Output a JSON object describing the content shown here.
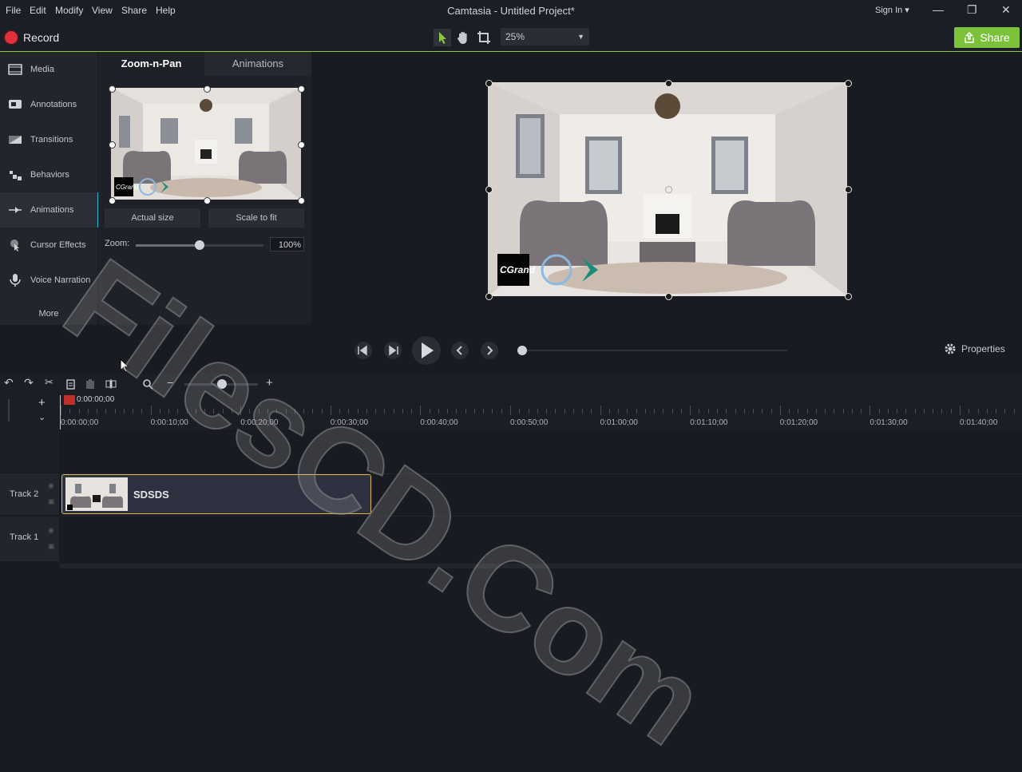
{
  "menu": [
    "File",
    "Edit",
    "Modify",
    "View",
    "Share",
    "Help"
  ],
  "window": {
    "title": "Camtasia - Untitled Project*",
    "sign_in": "Sign In ▾"
  },
  "toolbar": {
    "record_label": "Record",
    "zoom": "25%",
    "share_label": "Share"
  },
  "sidebar": {
    "items": [
      {
        "label": "Media",
        "icon": "film-icon"
      },
      {
        "label": "Annotations",
        "icon": "annotation-icon"
      },
      {
        "label": "Transitions",
        "icon": "transition-icon"
      },
      {
        "label": "Behaviors",
        "icon": "behavior-icon"
      },
      {
        "label": "Animations",
        "icon": "animation-icon",
        "active": true
      },
      {
        "label": "Cursor Effects",
        "icon": "cursor-icon"
      },
      {
        "label": "Voice Narration",
        "icon": "microphone-icon"
      }
    ],
    "more_label": "More"
  },
  "panel": {
    "tabs": [
      "Zoom-n-Pan",
      "Animations"
    ],
    "actual_size": "Actual size",
    "scale_to_fit": "Scale to fit",
    "zoom_label": "Zoom:",
    "zoom_value": "100%",
    "zoom_level": 0.5,
    "logo_text": "CGrand"
  },
  "canvas": {
    "logo_text": "CGrand"
  },
  "playback": {
    "properties_label": "Properties"
  },
  "timeline": {
    "current_time": "0:00:00;00",
    "ticks": [
      "0:00:00;00",
      "0:00:10;00",
      "0:00:20;00",
      "0:00:30;00",
      "0:00:40;00",
      "0:00:50;00",
      "0:01:00;00",
      "0:01:10;00",
      "0:01:20;00",
      "0:01:30;00",
      "0:01:40;00"
    ],
    "tracks": [
      "Track 2",
      "Track 1"
    ],
    "clip_label": "SDSDS"
  },
  "watermark": "FilesCD.Com",
  "colors": {
    "accent_green": "#7cc13a",
    "record_red": "#e0303a",
    "active_teal": "#25b7c8",
    "clip_border": "#e0b84a"
  }
}
